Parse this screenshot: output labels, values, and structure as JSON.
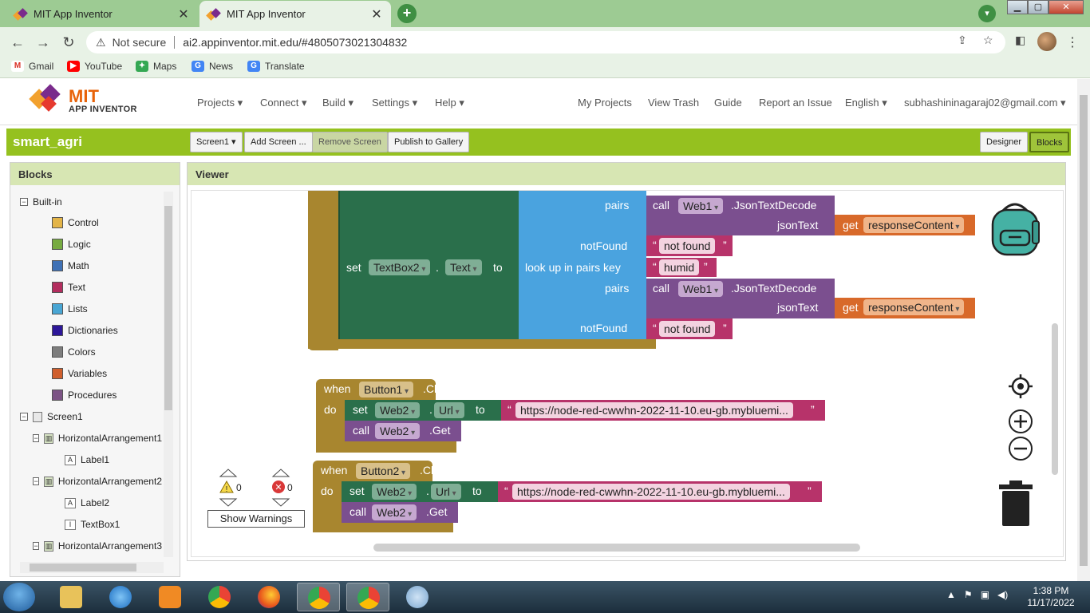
{
  "browser": {
    "tabs": [
      {
        "title": "MIT App Inventor",
        "active": false
      },
      {
        "title": "MIT App Inventor",
        "active": true
      }
    ],
    "address": {
      "security_label": "Not secure",
      "url": "ai2.appinventor.mit.edu/#4805073021304832"
    },
    "bookmarks": [
      {
        "label": "Gmail",
        "icon": "gmail-icon"
      },
      {
        "label": "YouTube",
        "icon": "youtube-icon"
      },
      {
        "label": "Maps",
        "icon": "maps-icon"
      },
      {
        "label": "News",
        "icon": "news-icon"
      },
      {
        "label": "Translate",
        "icon": "translate-icon"
      }
    ]
  },
  "appinventor": {
    "logo": {
      "line1": "MIT",
      "line2": "APP INVENTOR"
    },
    "nav_menus": [
      "Projects",
      "Connect",
      "Build",
      "Settings",
      "Help"
    ],
    "nav_links": [
      "My Projects",
      "View Trash",
      "Guide",
      "Report an Issue"
    ],
    "language": "English",
    "account": "subhashininagaraj02@gmail.com",
    "project": {
      "name": "smart_agri",
      "screen_select": "Screen1",
      "add_screen": "Add Screen ...",
      "remove_screen": "Remove Screen",
      "publish": "Publish to Gallery",
      "designer": "Designer",
      "blocks": "Blocks"
    },
    "blocks_panel": {
      "title": "Blocks",
      "builtin_label": "Built-in",
      "builtin": [
        {
          "label": "Control",
          "color": "#e3b447"
        },
        {
          "label": "Logic",
          "color": "#77ab41"
        },
        {
          "label": "Math",
          "color": "#3f71b5"
        },
        {
          "label": "Text",
          "color": "#b32d5e"
        },
        {
          "label": "Lists",
          "color": "#49a6d4"
        },
        {
          "label": "Dictionaries",
          "color": "#2d1799"
        },
        {
          "label": "Colors",
          "color": "#7d7d7d"
        },
        {
          "label": "Variables",
          "color": "#d05f2d"
        },
        {
          "label": "Procedures",
          "color": "#7c5385"
        }
      ],
      "components": [
        {
          "label": "Screen1",
          "level": 0
        },
        {
          "label": "HorizontalArrangement1",
          "level": 1
        },
        {
          "label": "Label1",
          "level": 2
        },
        {
          "label": "HorizontalArrangement2",
          "level": 1
        },
        {
          "label": "Label2",
          "level": 2
        },
        {
          "label": "TextBox1",
          "level": 2
        },
        {
          "label": "HorizontalArrangement3",
          "level": 1
        }
      ]
    },
    "viewer": {
      "title": "Viewer",
      "blocks": {
        "pairs1": "pairs",
        "call1": "call",
        "web1_a": "Web1",
        "decode1": ".JsonTextDecode",
        "jsontext1": "jsonText",
        "get1": "get",
        "resp1": "responseContent",
        "notfound_lbl1": "notFound",
        "notfound_val1": "not found",
        "set_lbl": "set",
        "textbox2": "TextBox2",
        "dot": ".",
        "text_prop": "Text",
        "to": "to",
        "lookup": "look up in pairs  key",
        "key_humid": "humid",
        "pairs2": "pairs",
        "call2": "call",
        "web1_b": "Web1",
        "decode2": ".JsonTextDecode",
        "jsontext2": "jsonText",
        "get2": "get",
        "resp2": "responseContent",
        "notfound_lbl2": "notFound",
        "notfound_val2": "not found",
        "b1_when": "when",
        "b1_button": "Button1",
        "b1_click": ".Click",
        "b1_do": "do",
        "b1_set": "set",
        "b1_web2": "Web2",
        "b1_url": "Url",
        "b1_to": "to",
        "b1_urltext": "https://node-red-cwwhn-2022-11-10.eu-gb.mybluemi...",
        "b1_call": "call",
        "b1_web2b": "Web2",
        "b1_get": ".Get",
        "b2_when": "when",
        "b2_button": "Button2",
        "b2_click": ".Click",
        "b2_do": "do",
        "b2_set": "set",
        "b2_web2": "Web2",
        "b2_url": "Url",
        "b2_to": "to",
        "b2_urltext": "https://node-red-cwwhn-2022-11-10.eu-gb.mybluemi...",
        "b2_call": "call",
        "b2_web2b": "Web2",
        "b2_get": ".Get"
      },
      "warnings": {
        "warning_count": "0",
        "error_count": "0",
        "button": "Show Warnings"
      }
    }
  },
  "taskbar": {
    "time": "1:38 PM",
    "date": "11/17/2022"
  }
}
